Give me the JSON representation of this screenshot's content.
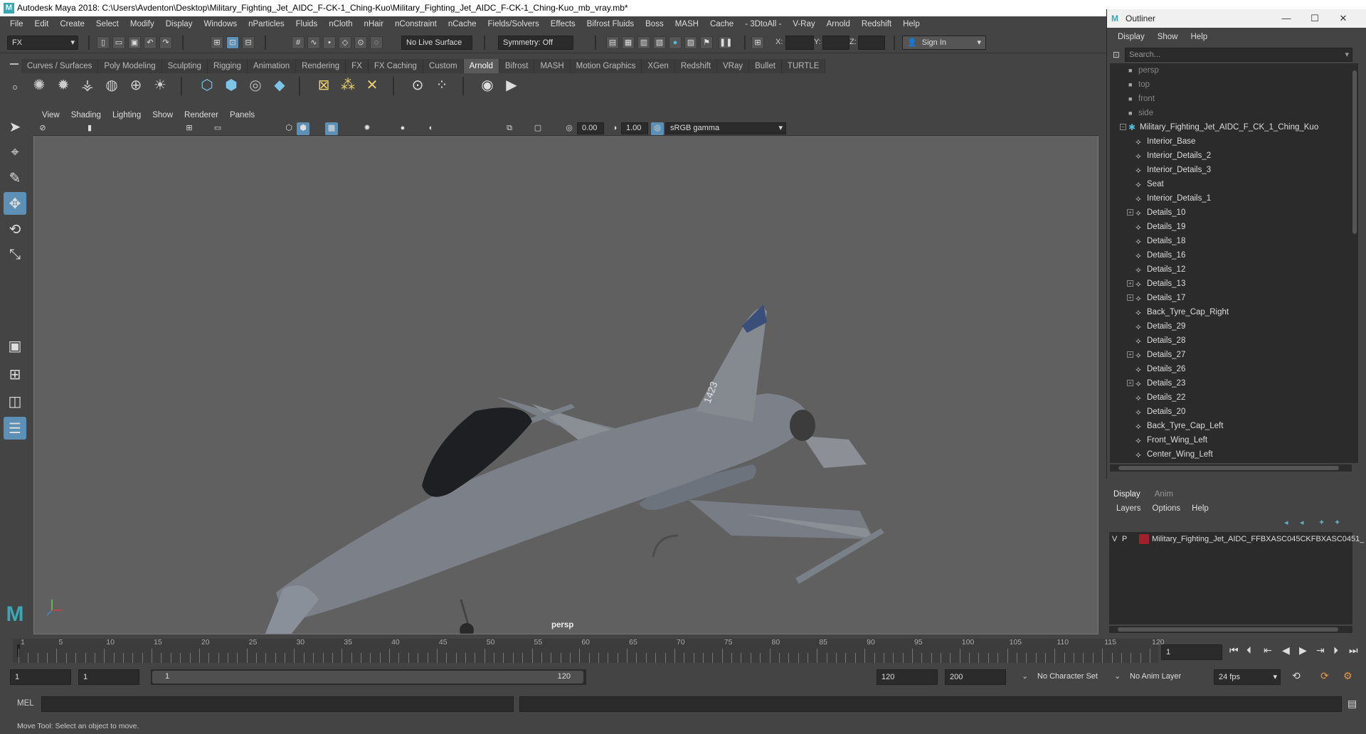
{
  "window": {
    "title": "Autodesk Maya 2018: C:\\Users\\Avdenton\\Desktop\\Military_Fighting_Jet_AIDC_F-CK-1_Ching-Kuo\\Military_Fighting_Jet_AIDC_F-CK-1_Ching-Kuo_mb_vray.mb*"
  },
  "menubar": [
    "File",
    "Edit",
    "Create",
    "Select",
    "Modify",
    "Display",
    "Windows",
    "nParticles",
    "Fluids",
    "nCloth",
    "nHair",
    "nConstraint",
    "nCache",
    "Fields/Solvers",
    "Effects",
    "Bifrost Fluids",
    "Boss",
    "MASH",
    "Cache",
    "- 3DtoAll -",
    "V-Ray",
    "Arnold",
    "Redshift",
    "Help"
  ],
  "statusline": {
    "menuset": "FX",
    "live_surface": "No Live Surface",
    "symmetry": "Symmetry: Off",
    "x_label": "X:",
    "y_label": "Y:",
    "z_label": "Z:",
    "sign_in": "Sign In"
  },
  "shelf": {
    "tabs": [
      "Curves / Surfaces",
      "Poly Modeling",
      "Sculpting",
      "Rigging",
      "Animation",
      "Rendering",
      "FX",
      "FX Caching",
      "Custom",
      "Arnold",
      "Bifrost",
      "MASH",
      "Motion Graphics",
      "XGen",
      "Redshift",
      "VRay",
      "Bullet",
      "TURTLE"
    ],
    "active": "Arnold"
  },
  "viewport": {
    "menu": [
      "View",
      "Shading",
      "Lighting",
      "Show",
      "Renderer",
      "Panels"
    ],
    "exposure": "0.00",
    "gamma": "1.00",
    "colorspace": "sRGB gamma",
    "camera_label": "persp",
    "fuselage_text": "1423"
  },
  "outliner": {
    "title": "Outliner",
    "menu": [
      "Display",
      "Show",
      "Help"
    ],
    "search_placeholder": "Search...",
    "cameras": [
      "persp",
      "top",
      "front",
      "side"
    ],
    "root": "Military_Fighting_Jet_AIDC_F_CK_1_Ching_Kuo",
    "children": [
      {
        "label": "Interior_Base",
        "expandable": false
      },
      {
        "label": "Interior_Details_2",
        "expandable": false
      },
      {
        "label": "Interior_Details_3",
        "expandable": false
      },
      {
        "label": "Seat",
        "expandable": false
      },
      {
        "label": "Interior_Details_1",
        "expandable": false
      },
      {
        "label": "Details_10",
        "expandable": true
      },
      {
        "label": "Details_19",
        "expandable": false
      },
      {
        "label": "Details_18",
        "expandable": false
      },
      {
        "label": "Details_16",
        "expandable": false
      },
      {
        "label": "Details_12",
        "expandable": false
      },
      {
        "label": "Details_13",
        "expandable": true
      },
      {
        "label": "Details_17",
        "expandable": true
      },
      {
        "label": "Back_Tyre_Cap_Right",
        "expandable": false
      },
      {
        "label": "Details_29",
        "expandable": false
      },
      {
        "label": "Details_28",
        "expandable": false
      },
      {
        "label": "Details_27",
        "expandable": true
      },
      {
        "label": "Details_26",
        "expandable": false
      },
      {
        "label": "Details_23",
        "expandable": true
      },
      {
        "label": "Details_22",
        "expandable": false
      },
      {
        "label": "Details_20",
        "expandable": false
      },
      {
        "label": "Back_Tyre_Cap_Left",
        "expandable": false
      },
      {
        "label": "Front_Wing_Left",
        "expandable": false
      },
      {
        "label": "Center_Wing_Left",
        "expandable": false
      }
    ]
  },
  "layers": {
    "tabs": [
      "Display",
      "Anim"
    ],
    "menu": [
      "Layers",
      "Options",
      "Help"
    ],
    "row": {
      "v": "V",
      "p": "P",
      "name": "Military_Fighting_Jet_AIDC_FFBXASC045CKFBXASC0451_",
      "color": "#a0202c"
    }
  },
  "timeline": {
    "ticks": [
      "1",
      "5",
      "10",
      "15",
      "20",
      "25",
      "30",
      "35",
      "40",
      "45",
      "50",
      "55",
      "60",
      "65",
      "70",
      "75",
      "80",
      "85",
      "90",
      "95",
      "100",
      "105",
      "110",
      "115",
      "120"
    ],
    "current_frame": "1"
  },
  "range": {
    "start": "1",
    "inner_start": "1",
    "slider_start": "1",
    "slider_end": "120",
    "end": "120",
    "max": "200",
    "character_set": "No Character Set",
    "anim_layer": "No Anim Layer",
    "fps": "24 fps"
  },
  "mel": {
    "label": "MEL"
  },
  "help": {
    "text": "Move Tool: Select an object to move."
  }
}
